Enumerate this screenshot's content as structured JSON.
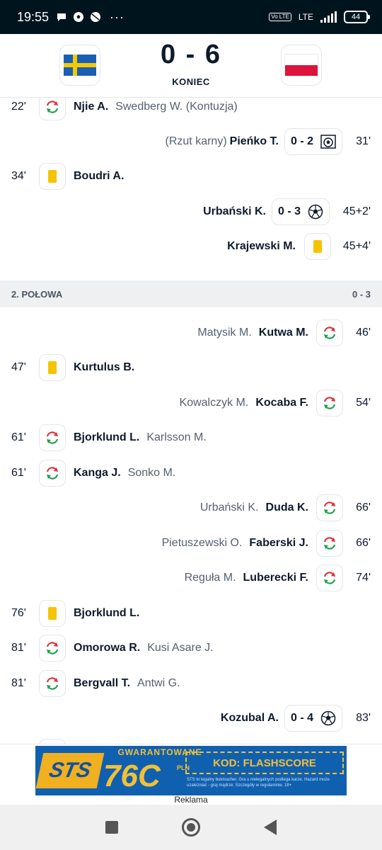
{
  "status_bar": {
    "time": "19:55",
    "overflow": "···",
    "volte": "Vo LTE",
    "network": "LTE",
    "battery": "44"
  },
  "header": {
    "score": "0 - 6",
    "status": "KONIEC",
    "home_flag": "sweden-flag",
    "away_flag": "poland-flag"
  },
  "events_first_half": [
    {
      "side": "home",
      "type": "substitution",
      "minute": "22'",
      "player": "Njie A.",
      "other": "Swedberg W. (Kontuzja)"
    },
    {
      "side": "away",
      "type": "penalty-goal",
      "minute": "31'",
      "note": "(Rzut karny)",
      "player": "Pieńko T.",
      "score": "0 - 2"
    },
    {
      "side": "home",
      "type": "yellow-card",
      "minute": "34'",
      "player": "Boudri A."
    },
    {
      "side": "away",
      "type": "goal",
      "minute": "45+2'",
      "player": "Urbański K.",
      "score": "0 - 3"
    },
    {
      "side": "away",
      "type": "yellow-card",
      "minute": "45+4'",
      "player": "Krajewski M."
    }
  ],
  "section_second_half": {
    "title": "2. POŁOWA",
    "score": "0 - 3"
  },
  "events_second_half": [
    {
      "side": "away",
      "type": "substitution",
      "minute": "46'",
      "player": "Kutwa M.",
      "other": "Matysik M."
    },
    {
      "side": "home",
      "type": "yellow-card",
      "minute": "47'",
      "player": "Kurtulus B."
    },
    {
      "side": "away",
      "type": "substitution",
      "minute": "54'",
      "player": "Kocaba F.",
      "other": "Kowalczyk M."
    },
    {
      "side": "home",
      "type": "substitution",
      "minute": "61'",
      "player": "Bjorklund L.",
      "other": "Karlsson M."
    },
    {
      "side": "home",
      "type": "substitution",
      "minute": "61'",
      "player": "Kanga J.",
      "other": "Sonko M."
    },
    {
      "side": "away",
      "type": "substitution",
      "minute": "66'",
      "player": "Duda K.",
      "other": "Urbański K."
    },
    {
      "side": "away",
      "type": "substitution",
      "minute": "66'",
      "player": "Faberski J.",
      "other": "Pietuszewski O."
    },
    {
      "side": "away",
      "type": "substitution",
      "minute": "74'",
      "player": "Luberecki F.",
      "other": "Reguła M."
    },
    {
      "side": "home",
      "type": "yellow-card",
      "minute": "76'",
      "player": "Bjorklund L."
    },
    {
      "side": "home",
      "type": "substitution",
      "minute": "81'",
      "player": "Omorowa R.",
      "other": "Kusi Asare J."
    },
    {
      "side": "home",
      "type": "substitution",
      "minute": "81'",
      "player": "Bergvall T.",
      "other": "Antwi G."
    },
    {
      "side": "away",
      "type": "goal",
      "minute": "83'",
      "player": "Kozubal A.",
      "score": "0 - 4"
    }
  ],
  "ad": {
    "brand": "STS",
    "headline": "GWARANTOWANE",
    "amount": "76C",
    "currency": "PLN",
    "code": "KOD: FLASHSCORE",
    "legal": "STS to legalny bukmacher. Gra u nielegalnych podlega karze. Hazard może uzależniać - graj mądrze. Szczegóły w regulaminie. 18+",
    "label": "Reklama"
  },
  "colors": {
    "statusbar": "#00141e",
    "card_yellow": "#f5c400",
    "sub_red": "#e0303a",
    "sub_green": "#20a050",
    "section_bg": "#eef0f2"
  }
}
